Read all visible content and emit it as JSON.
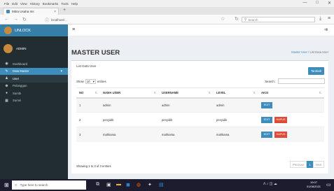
{
  "browser": {
    "menu": [
      "File",
      "Edit",
      "View",
      "History",
      "Bookmarks",
      "Tools",
      "Help"
    ],
    "tab_title": "Mitra Usaha Ins",
    "url": "localhost/...",
    "search_placeholder": "Search",
    "window_controls": [
      "—",
      "□",
      "✕"
    ]
  },
  "sidebar": {
    "brand": "UNLOCK",
    "user": "ADMIN",
    "items": [
      {
        "label": "Dashboard",
        "icon": "dashboard-icon"
      },
      {
        "label": "Data Master",
        "icon": "wrench-icon"
      },
      {
        "label": "User",
        "icon": "user-icon"
      },
      {
        "label": "Pelanggan",
        "icon": "users-icon"
      },
      {
        "label": "Sumbi",
        "icon": "circle-icon"
      },
      {
        "label": "Sumni",
        "icon": "bank-icon"
      }
    ]
  },
  "page": {
    "title": "MASTER USER",
    "breadcrumb": [
      "Master User",
      "List Data User"
    ],
    "breadcrumb_sep": "/"
  },
  "box": {
    "title": "List Data User",
    "add_button": "Tambah",
    "show_label": "Show",
    "show_value": "10",
    "entries_label": "entries",
    "search_label": "Search:"
  },
  "table": {
    "headers": [
      "NO",
      "NAMA USER",
      "USERNAME",
      "LEVEL",
      "AKSI"
    ],
    "rows": [
      {
        "no": "1",
        "nama": "admin",
        "username": "admin",
        "level": "admin",
        "edit": "EDIT",
        "delete": ""
      },
      {
        "no": "2",
        "nama": "penyidik",
        "username": "penyidik",
        "level": "penyidik",
        "edit": "EDIT",
        "delete": "HAPUS"
      },
      {
        "no": "3",
        "nama": "mahkama",
        "username": "mahkama",
        "level": "mahkama",
        "edit": "EDIT",
        "delete": "HAPUS"
      }
    ],
    "info": "Showing 1 to 3 of 3 entries",
    "pagination": {
      "prev": "Previous",
      "current": "1",
      "next": "Next"
    }
  },
  "taskbar": {
    "search_placeholder": "Type here to search",
    "time": "19:07",
    "date": "01/08/2021"
  },
  "colors": {
    "primary": "#3c8dbc",
    "danger": "#dd4b39",
    "sidebar": "#222d32",
    "content_bg": "#ecf0f5"
  }
}
